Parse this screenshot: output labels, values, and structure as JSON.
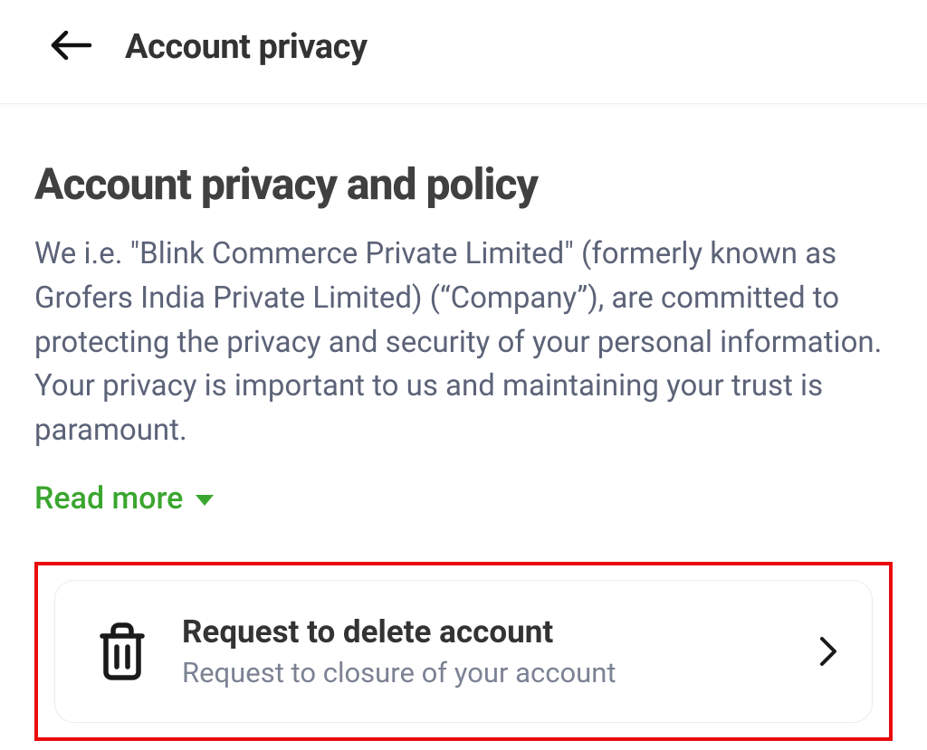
{
  "header": {
    "title": "Account privacy"
  },
  "main": {
    "heading": "Account privacy and policy",
    "description": "We i.e. \"Blink Commerce Private Limited\" (formerly known as Grofers India Private Limited) (“Company”), are committed to protecting the privacy and security of your personal information. Your privacy is important to us and maintaining your trust is paramount.",
    "read_more_label": "Read more"
  },
  "delete_card": {
    "title": "Request to delete account",
    "subtitle": "Request to closure of your account"
  }
}
